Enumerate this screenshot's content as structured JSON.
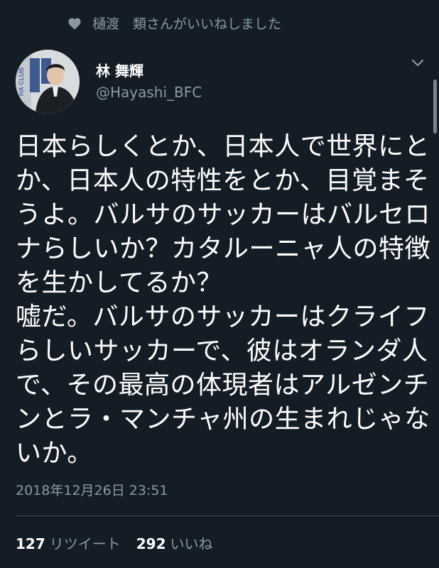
{
  "social_context": {
    "icon": "heart-icon",
    "text": "樋渡　類さんがいいねしました"
  },
  "author": {
    "display_name": "林 舞輝",
    "handle": "@Hayashi_BFC",
    "avatar_text": "HA CLUB"
  },
  "menu": {
    "icon": "chevron-down-icon"
  },
  "tweet": {
    "text": "日本らしくとか、日本人で世界にとか、日本人の特性をとか、目覚まそうよ。バルサのサッカーはバルセロナらしいか？カタルーニャ人の特徴を生かしてるか？\n嘘だ。バルサのサッカーはクライフらしいサッカーで、彼はオランダ人で、その最高の体現者はアルゼンチンとラ・マンチャ州の生まれじゃないか。",
    "timestamp": "2018年12月26日 23:51"
  },
  "stats": {
    "retweets_count": "127",
    "retweets_label": "リツイート",
    "likes_count": "292",
    "likes_label": "いいね"
  },
  "colors": {
    "background": "#141d26",
    "secondary_text": "#8899a6",
    "divider": "#38444d"
  }
}
